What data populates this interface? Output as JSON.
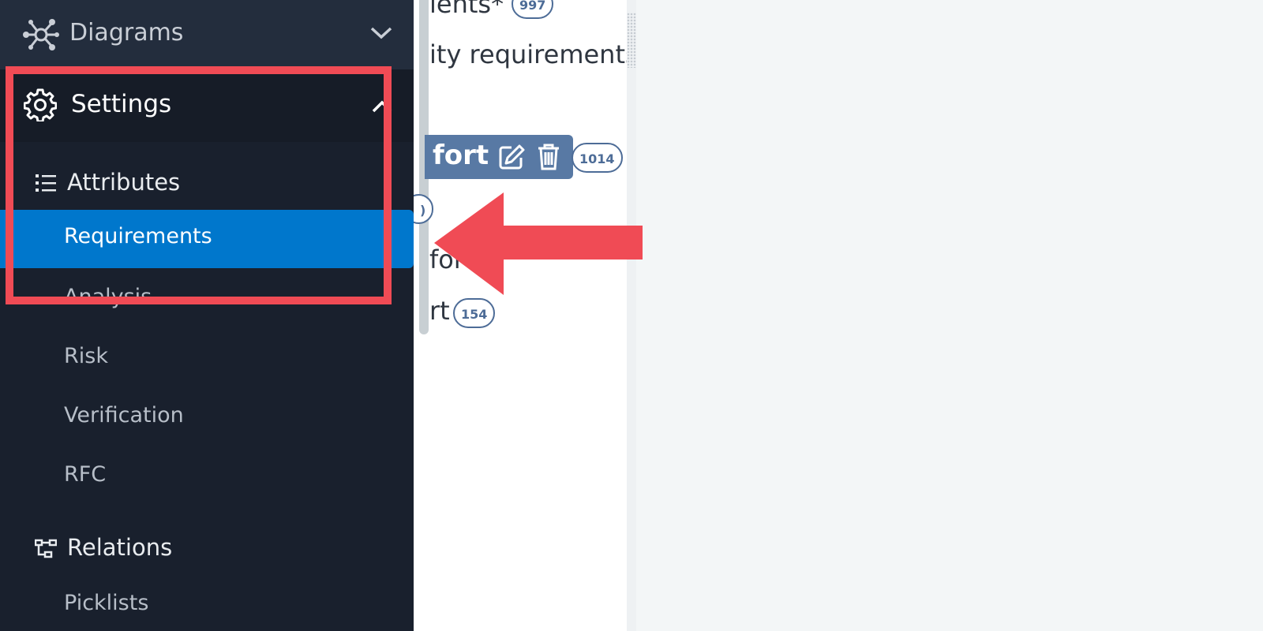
{
  "sidebar": {
    "diagrams_label": "Diagrams",
    "settings_label": "Settings",
    "attributes_label": "Attributes",
    "requirements_label": "Requirements",
    "analysis_label": "Analysis",
    "risk_label": "Risk",
    "verification_label": "Verification",
    "rfc_label": "RFC",
    "relations_label": "Relations",
    "picklists_label": "Picklists"
  },
  "content": {
    "line1_text": "ients*",
    "line1_count": "997",
    "line2_text": "ity requirements",
    "tag_text": "fort",
    "tag_count": "1014",
    "line4_partial": ")",
    "line5_text": "fort",
    "line6_text": "rt",
    "line6_count": "154"
  },
  "colors": {
    "sidebar_bg": "#19202d",
    "active_bg": "#0077cc",
    "highlight": "#f04b55",
    "tag_bg": "#5879a4"
  }
}
